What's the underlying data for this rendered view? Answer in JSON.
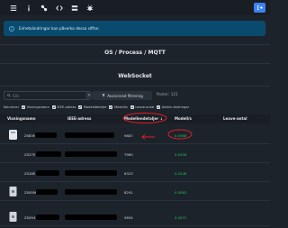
{
  "nav": {
    "items": [
      {
        "name": "menu-icon"
      },
      {
        "name": "info-icon"
      },
      {
        "name": "devices-icon"
      },
      {
        "name": "code-icon"
      },
      {
        "name": "network-icon"
      },
      {
        "name": "bug-icon"
      }
    ],
    "logout_icon": "logout-icon"
  },
  "alert": {
    "text": "Enhetsändringar kan påverka dessa siffror."
  },
  "sections": {
    "os_process_mqtt": "OS / Process / MQTT",
    "websocket": "WebSocket"
  },
  "toolbar": {
    "search_placeholder": "Sök",
    "clear_label": "×",
    "advanced_filter_label": "Avancerad filtrering",
    "posts_label": "Poster: 121"
  },
  "column_toggles": {
    "label": "Kolumner",
    "items": [
      "Visningsnamn",
      "IEEE-adress",
      "Modelldetaljer",
      "Modell/s",
      "Leave-antal",
      "Admin-ändringar"
    ]
  },
  "table": {
    "headers": {
      "name": "Visningsnamn",
      "ieee": "IEEE-adress",
      "model": "Modellendetaljer ↓",
      "rate": "Modell/s",
      "leave": "Leave-antal"
    },
    "rows": [
      {
        "name": "Z083M",
        "model": "9887",
        "rate": "0.0988"
      },
      {
        "name": "Z027E",
        "model": "7960",
        "rate": "0.0458"
      },
      {
        "name": "Z028E",
        "model": "6323",
        "rate": "0.0246"
      },
      {
        "name": "Z005M",
        "model": "8291",
        "rate": "0.0062"
      },
      {
        "name": "Z0094",
        "model": "5654",
        "rate": "0.0037"
      }
    ]
  },
  "colors": {
    "background": "#1d232a",
    "navbar": "#191e24",
    "alert": "#0b4a6f",
    "accent": "#3b82f6",
    "rate_green": "#22c55e",
    "annotation_red": "#e11d2a"
  }
}
